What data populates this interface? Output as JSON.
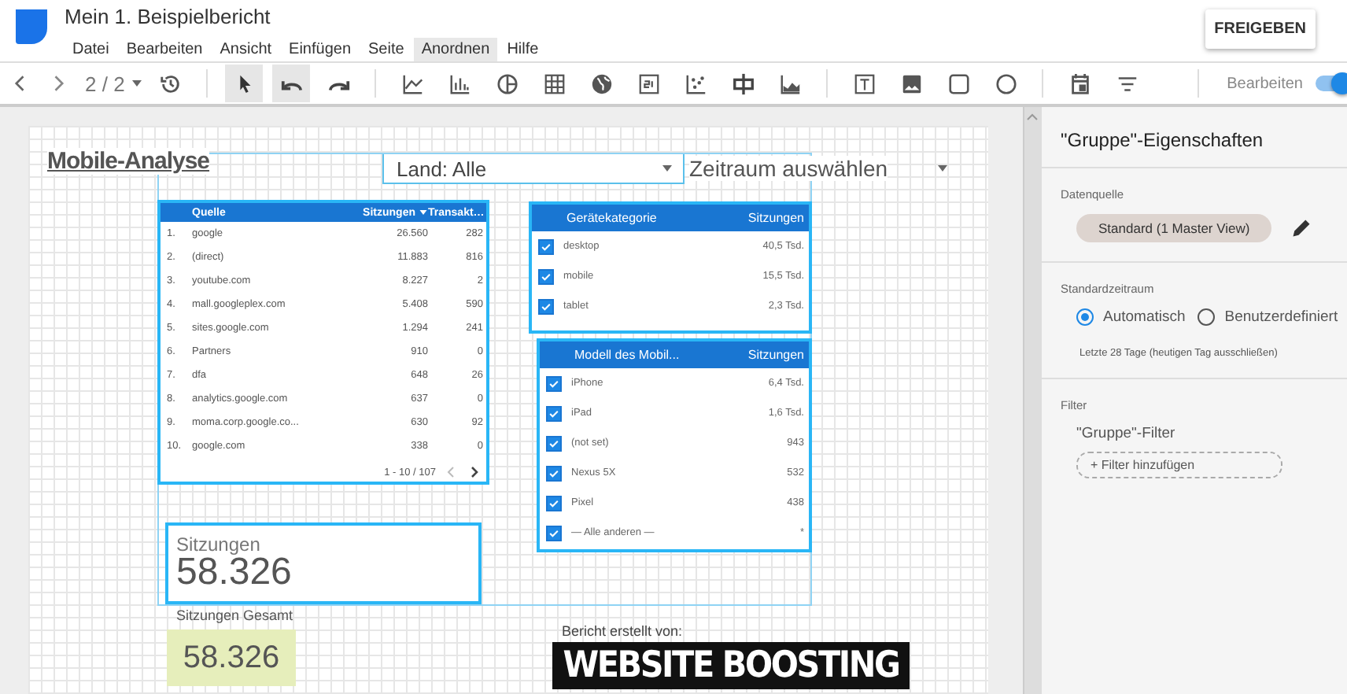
{
  "app": {
    "title": "Mein 1. Beispielbericht",
    "share_button": "FREIGEBEN",
    "menu": [
      {
        "label": "Datei",
        "selected": false
      },
      {
        "label": "Bearbeiten",
        "selected": false
      },
      {
        "label": "Ansicht",
        "selected": false
      },
      {
        "label": "Einfügen",
        "selected": false
      },
      {
        "label": "Seite",
        "selected": false
      },
      {
        "label": "Anordnen",
        "selected": true
      },
      {
        "label": "Hilfe",
        "selected": false
      }
    ]
  },
  "toolbar": {
    "page": "2 / 2",
    "groups": [
      [
        {
          "kind": "history",
          "selected": false
        }
      ],
      [
        {
          "kind": "select",
          "selected": true
        },
        {
          "kind": "undo",
          "selected": true
        },
        {
          "kind": "redo",
          "selected": false
        }
      ],
      [
        {
          "kind": "line",
          "selected": false
        },
        {
          "kind": "bar",
          "selected": false
        },
        {
          "kind": "pie",
          "selected": false
        },
        {
          "kind": "table",
          "selected": false
        },
        {
          "kind": "geo",
          "selected": false
        },
        {
          "kind": "scorecard",
          "selected": false
        },
        {
          "kind": "scatter",
          "selected": false
        },
        {
          "kind": "bullet",
          "selected": false
        },
        {
          "kind": "area",
          "selected": false
        }
      ],
      [
        {
          "kind": "text",
          "selected": false
        },
        {
          "kind": "image",
          "selected": false
        },
        {
          "kind": "rectangle",
          "selected": false
        },
        {
          "kind": "circle",
          "selected": false
        }
      ],
      [
        {
          "kind": "date",
          "selected": false
        },
        {
          "kind": "filter",
          "selected": false
        }
      ]
    ],
    "edit_toggle": {
      "label": "Bearbeiten",
      "on": true
    }
  },
  "report": {
    "title": "Mobile-Analyse",
    "country_filter": "Land: Alle",
    "date_range": "Zeitraum auswählen",
    "table": {
      "columns": [
        {},
        {
          "label": "Quelle",
          "sorted": false
        },
        {
          "label": "Sitzungen",
          "sorted": true
        },
        {
          "label": "Transakt…",
          "sorted": false
        }
      ],
      "rows": [
        [
          "1.",
          "google",
          "26.560",
          "282"
        ],
        [
          "2.",
          "(direct)",
          "11.883",
          "816"
        ],
        [
          "3.",
          "youtube.com",
          "8.227",
          "2"
        ],
        [
          "4.",
          "mall.googleplex.com",
          "5.408",
          "590"
        ],
        [
          "5.",
          "sites.google.com",
          "1.294",
          "241"
        ],
        [
          "6.",
          "Partners",
          "910",
          "0"
        ],
        [
          "7.",
          "dfa",
          "648",
          "26"
        ],
        [
          "8.",
          "analytics.google.com",
          "637",
          "0"
        ],
        [
          "9.",
          "moma.corp.google.co...",
          "630",
          "92"
        ],
        [
          "10.",
          "google.com",
          "338",
          "0"
        ]
      ],
      "pagination": "1 - 10 / 107"
    },
    "device_filter": {
      "columns": [
        "Gerätekategorie",
        "Sitzungen"
      ],
      "rows": [
        {
          "label": "desktop",
          "value": "40,5 Tsd.",
          "checked": true
        },
        {
          "label": "mobile",
          "value": "15,5 Tsd.",
          "checked": true
        },
        {
          "label": "tablet",
          "value": "2,3 Tsd.",
          "checked": true
        }
      ]
    },
    "model_filter": {
      "columns": [
        "Modell des Mobil...",
        "Sitzungen"
      ],
      "rows": [
        {
          "label": "iPhone",
          "value": "6,4 Tsd.",
          "checked": true
        },
        {
          "label": "iPad",
          "value": "1,6 Tsd.",
          "checked": true
        },
        {
          "label": "(not set)",
          "value": "943",
          "checked": true
        },
        {
          "label": "Nexus 5X",
          "value": "532",
          "checked": true
        },
        {
          "label": "Pixel",
          "value": "438",
          "checked": true
        },
        {
          "label": "— Alle anderen —",
          "value": "*",
          "checked": true
        }
      ]
    },
    "scorecard": {
      "label": "Sitzungen",
      "value": "58.326"
    },
    "total": {
      "label": "Sitzungen Gesamt",
      "value": "58.326"
    },
    "credit": {
      "text": "Bericht erstellt von:",
      "logo": "WEBSITE BOOSTING"
    }
  },
  "panel": {
    "title": "\"Gruppe\"-Eigenschaften",
    "data_source": {
      "label": "Datenquelle",
      "value": "Standard (1 Master View)"
    },
    "date_range": {
      "label": "Standardzeitraum",
      "options": [
        {
          "label": "Automatisch",
          "selected": true
        },
        {
          "label": "Benutzerdefiniert",
          "selected": false
        }
      ],
      "hint": "Letzte 28 Tage (heutigen Tag ausschließen)"
    },
    "filter": {
      "label": "Filter",
      "name": "\"Gruppe\"-Filter",
      "add_button": "+ Filter hinzufügen"
    }
  }
}
